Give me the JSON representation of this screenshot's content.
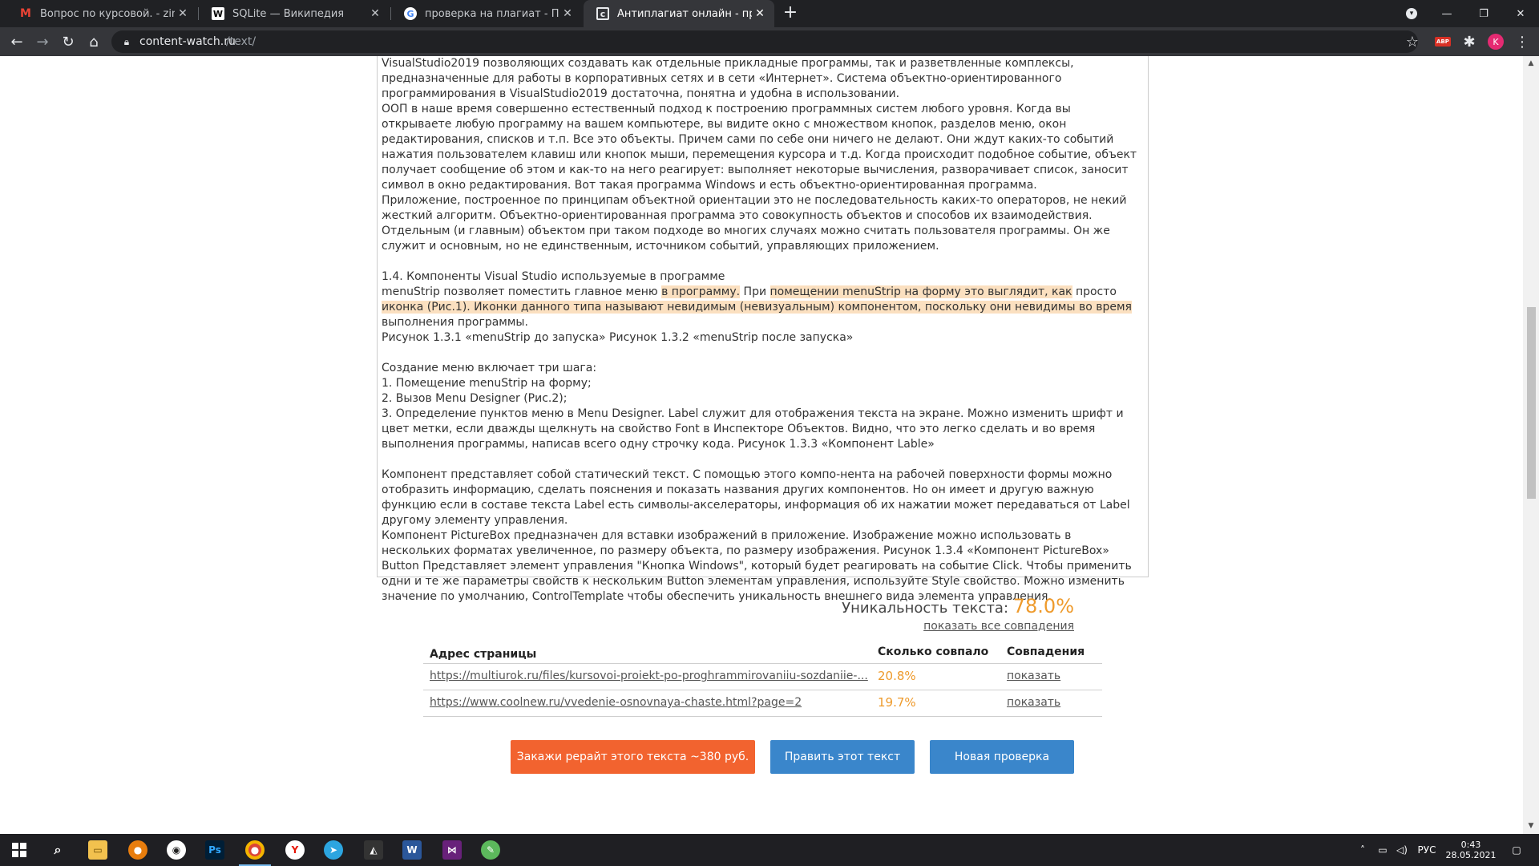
{
  "browser": {
    "tabs": [
      {
        "title": "Вопрос по курсовой. - zinchenk",
        "icon": "gmail-icon",
        "active": false
      },
      {
        "title": "SQLite — Википедия",
        "icon": "wikipedia-icon",
        "active": false
      },
      {
        "title": "проверка на плагиат - Поиск в",
        "icon": "google-icon",
        "active": false
      },
      {
        "title": "Антиплагиат онлайн - провери",
        "icon": "content-watch-icon",
        "active": true
      }
    ],
    "new_tab": "+",
    "url_host": "content-watch.ru",
    "url_path": "/text/",
    "abp_badge": "ABP",
    "profile_initial": "K"
  },
  "text": {
    "p1": "VisualStudio2019 позволяющих создавать как отдельные прикладные программы, так и разветвленные комплексы, предназначенные для работы в корпоративных сетях и в сети «Интернет». Система объектно-ориентированного программирования в VisualStudio2019 достаточна, понятна и удобна в использовании.",
    "p2": "ООП в наше время совершенно естественный подход к построению программных систем любого уровня. Когда вы открываете любую программу на вашем компьютере, вы видите окно с множеством кнопок, разделов меню, окон редактирования, списков и т.п. Все это объекты. Причем сами по себе они ничего не делают. Они ждут каких-то событий нажатия пользователем клавиш или кнопок мыши, перемещения курсора и т.д. Когда происходит подобное событие, объект получает сообщение об этом и как-то на него реагирует: выполняет некоторые вычисления, разворачивает список, заносит символ в окно редактирования. Вот такая программа Windows и есть объектно-ориентированная программа.",
    "p3": "Приложение, построенное по принципам объектной ориентации это не последовательность каких-то операторов, не некий жесткий алгоритм. Объектно-ориентированная программа это совокупность объектов и способов их взаимодействия. Отдельным (и главным) объектом при таком подходе во многих случаях можно считать пользователя программы. Он же служит и основным, но не единственным, источником событий, управляющих приложением.",
    "heading": "1.4. Компоненты Visual Studio используемые в программе",
    "m1": "menuStrip позволяет поместить главное меню ",
    "m2": "в программу.",
    "m3": " При ",
    "m4": "помещении menuStrip на форму это выглядит, как",
    "m5": " просто ",
    "m6": "иконка (Рис.1). Иконки данного типа называют невидимым (невизуальным) компонентом, поскольку они невидимы во время",
    "m7": " выполнения программы.",
    "figs": "Рисунок 1.3.1 «menuStrip до запуска» Рисунок 1.3.2 «menuStrip после запуска»",
    "steps_title": "Создание меню включает три шага:",
    "step1": "1. Помещение menuStrip на форму;",
    "step2": "2. Вызов Menu Designer (Рис.2);",
    "step3": "3. Определение пунктов меню в Menu Designer. Label служит для отображения текста на экране. Можно изменить шрифт и цвет метки, если дважды щелкнуть на свойство Font в Инспекторе Объектов. Видно, что это легко сделать и во время выполнения программы, написав всего одну строчку кода. Рисунок 1.3.3 «Компонент Lable»",
    "p4": "Компонент представляет собой статический текст. С помощью этого компо-нента на рабочей поверхности формы можно отобразить информацию, сделать пояснения и показать названия других компонентов. Но он имеет и другую важную функцию если в составе текста Label есть символы-акселераторы, информация об их нажатии может передаваться от Label другому элементу управления.",
    "p5": "Компонент PictureBox предназначен для вставки изображений в приложение. Изображение можно использовать в нескольких форматах увеличенное, по размеру объекта, по размеру изображения. Рисунок 1.3.4 «Компонент PictureBox» Button Представляет элемент управления \"Кнопка Windows\", который будет реагировать на событие Click. Чтобы применить одни и те же параметры свойств к нескольким Button элементам управления, используйте Style свойство. Можно изменить значение по умолчанию, ControlTemplate чтобы обеспечить уникальность внешнего вида элемента управления."
  },
  "result": {
    "uniq_label": "Уникальность текста: ",
    "uniq_value": "78.0%",
    "show_all": "показать все совпадения",
    "columns": [
      "Адрес страницы",
      "Сколько совпало",
      "Совпадения"
    ],
    "rows": [
      {
        "url": "https://multiurok.ru/files/kursovoi-proiekt-po-proghrammirovaniiu-sozdaniie-...",
        "pct": "20.8%",
        "action": "показать"
      },
      {
        "url": "https://www.coolnew.ru/vvedenie-osnovnaya-chaste.html?page=2",
        "pct": "19.7%",
        "action": "показать"
      }
    ]
  },
  "buttons": {
    "rewrite": "Закажи рерайт этого текста ~380 руб.",
    "edit": "Править этот текст",
    "new_check": "Новая проверка"
  },
  "taskbar": {
    "apps": [
      "start-icon",
      "search-icon",
      "file-explorer-icon",
      "blender-icon",
      "obs-icon",
      "photoshop-icon",
      "chrome-icon",
      "yandex-icon",
      "telegram-icon",
      "app-icon",
      "word-icon",
      "visual-studio-icon",
      "paint-icon"
    ],
    "lang": "РУС",
    "time": "0:43",
    "date": "28.05.2021"
  },
  "colors": {
    "accent_orange": "#ee9a2b",
    "button_orange": "#f2632f",
    "button_blue": "#3a86cb",
    "highlight": "#fbe0c0"
  }
}
